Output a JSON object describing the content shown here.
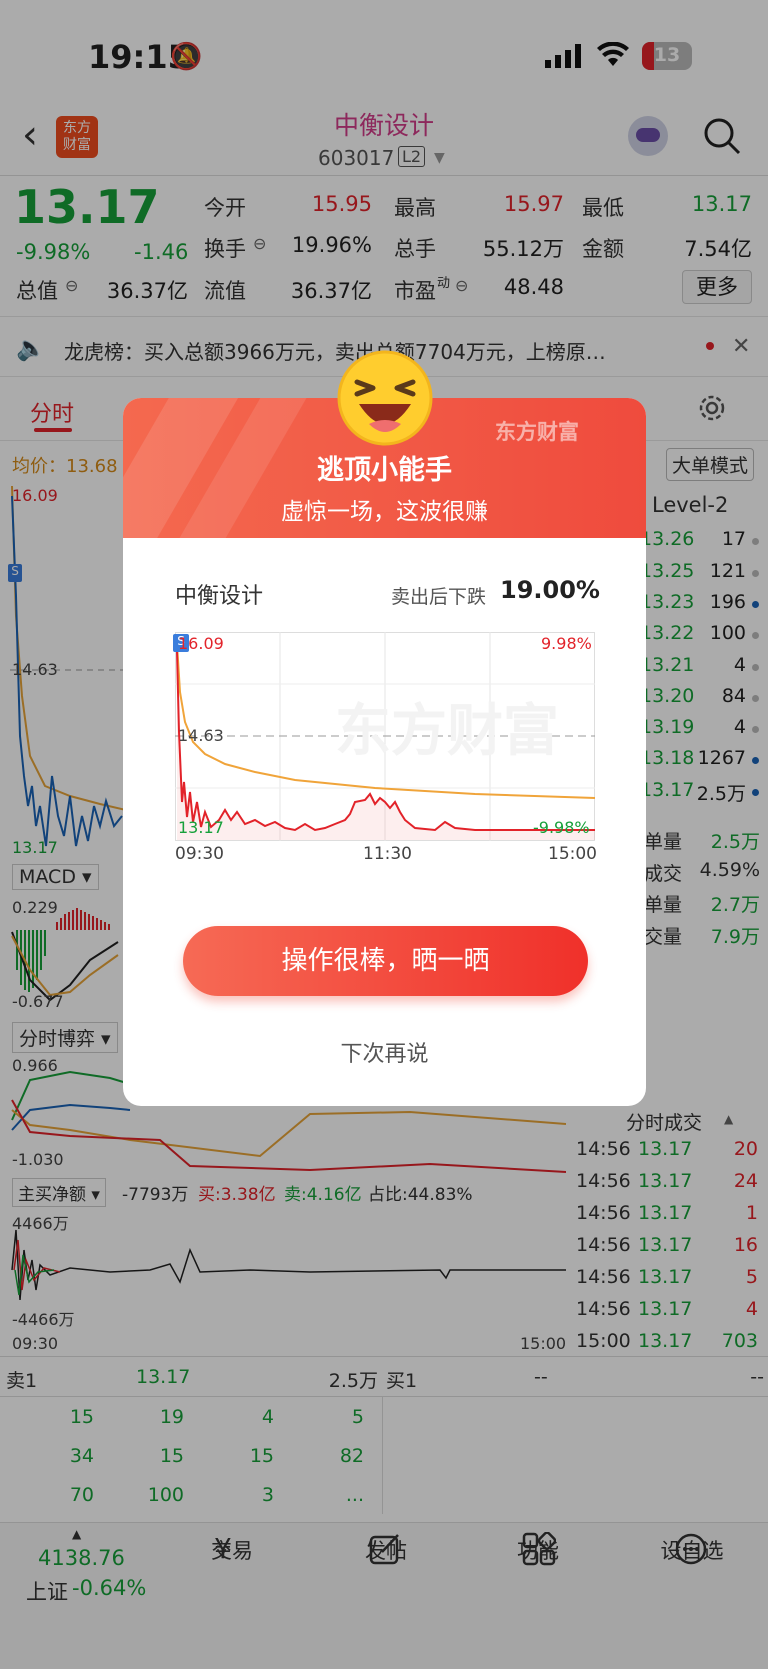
{
  "status_bar": {
    "time": "19:15",
    "battery": "13"
  },
  "header": {
    "back_label": "‹",
    "logo_line1": "东方",
    "logo_line2": "财富",
    "title": "中衡设计",
    "code": "603017",
    "level_badge": "L2"
  },
  "quote": {
    "price": "13.17",
    "pct": "-9.98%",
    "change": "-1.46",
    "open_label": "今开",
    "open": "15.95",
    "high_label": "最高",
    "high": "15.97",
    "low_label": "最低",
    "low": "13.17",
    "turnover_label": "换手",
    "turnover": "19.96%",
    "volume_label": "总手",
    "volume": "55.12万",
    "amount_label": "金额",
    "amount": "7.54亿",
    "mcap_label": "总值",
    "mcap": "36.37亿",
    "float_label": "流值",
    "float": "36.37亿",
    "pe_label": "市盈",
    "pe_sup": "动",
    "pe": "48.48",
    "more_label": "更多"
  },
  "notice": {
    "text": "龙虎榜：买入总额3966万元，卖出总额7704万元，上榜原…"
  },
  "tabs": {
    "active": "分时"
  },
  "chart_area": {
    "avg_label": "均价：13.68",
    "big_order_mode": "大单模式",
    "top_price": "16.09",
    "mid_price": "14.63",
    "bottom_price": "13.17",
    "macd_label": "MACD",
    "macd_top": "0.229",
    "macd_bottom": "-0.677",
    "game_label": "分时博弈",
    "game_top": "0.966",
    "game_bottom": "-1.030",
    "net_label": "主买净额",
    "net_value": "-7793万",
    "net_buy": "买:3.38亿",
    "net_sell": "卖:4.16亿",
    "net_ratio": "占比:44.83%",
    "net_top": "4466万",
    "net_bottom": "-4466万",
    "time_start": "09:30",
    "time_end": "15:00"
  },
  "order_book": {
    "title": "Level-2",
    "rows": [
      {
        "price": "13.26",
        "qty": "17"
      },
      {
        "price": "13.25",
        "qty": "121"
      },
      {
        "price": "13.23",
        "qty": "196"
      },
      {
        "price": "13.22",
        "qty": "100"
      },
      {
        "price": "13.21",
        "qty": "4"
      },
      {
        "price": "13.20",
        "qty": "84"
      },
      {
        "price": "13.19",
        "qty": "4"
      },
      {
        "price": "13.18",
        "qty": "1267"
      },
      {
        "price": "13.17",
        "qty": "2.5万"
      }
    ],
    "stats": [
      {
        "label": "单量",
        "value": "2.5万"
      },
      {
        "label": "成交",
        "value": "4.59%"
      },
      {
        "label": "单量",
        "value": "2.7万"
      },
      {
        "label": "交量",
        "value": "7.9万"
      }
    ]
  },
  "trades": {
    "title": "分时成交",
    "rows": [
      {
        "time": "14:56",
        "price": "13.17",
        "vol": "20"
      },
      {
        "time": "14:56",
        "price": "13.17",
        "vol": "24"
      },
      {
        "time": "14:56",
        "price": "13.17",
        "vol": "1"
      },
      {
        "time": "14:56",
        "price": "13.17",
        "vol": "16"
      },
      {
        "time": "14:56",
        "price": "13.17",
        "vol": "5"
      },
      {
        "time": "14:56",
        "price": "13.17",
        "vol": "4"
      },
      {
        "time": "15:00",
        "price": "13.17",
        "vol": "703"
      }
    ]
  },
  "queue": {
    "sell1_label": "卖1",
    "sell1_price": "13.17",
    "sell1_vol": "2.5万",
    "buy1_label": "买1",
    "buy1_price": "--",
    "buy1_vol": "--",
    "rows": [
      [
        "15",
        "19",
        "4",
        "5"
      ],
      [
        "34",
        "15",
        "15",
        "82"
      ],
      [
        "70",
        "100",
        "3",
        "..."
      ]
    ]
  },
  "bottom_bar": {
    "index_value": "4138.76",
    "index_name": "上证",
    "index_pct": "-0.64%",
    "items": [
      {
        "label": "交易"
      },
      {
        "label": "发帖"
      },
      {
        "label": "功能"
      },
      {
        "label": "设自选"
      }
    ]
  },
  "modal": {
    "brand": "东方财富",
    "title": "逃顶小能手",
    "subtitle": "虚惊一场，这波很赚",
    "stock_name": "中衡设计",
    "drop_label": "卖出后下跌",
    "drop_value": "19.00%",
    "chart": {
      "top_left": "16.09",
      "top_right": "9.98%",
      "mid_left": "14.63",
      "bottom_left": "13.17",
      "bottom_right": "-9.98%",
      "x_labels": [
        "09:30",
        "11:30",
        "15:00"
      ]
    },
    "share_button": "操作很棒，晒一晒",
    "later_button": "下次再说"
  },
  "colors": {
    "up": "#e2232a",
    "down": "#17a03a",
    "accent": "#f0302a",
    "title_pink": "#d23c8a"
  }
}
